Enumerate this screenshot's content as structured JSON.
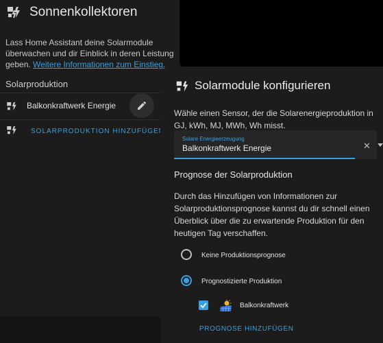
{
  "left_card": {
    "title": "Sonnenkollektoren",
    "description": "Lass Home Assistant deine Solarmodule überwachen und dir Einblick in deren Leistung geben.",
    "link_text": "Weitere Informationen zum Einstieg.",
    "section_label": "Solarproduktion",
    "source_label": "Balkonkraftwerk Energie",
    "add_label": "SOLARPRODUKTION HINZUFÜGEN",
    "icons": [
      "solar-power-icon",
      "pencil-icon"
    ]
  },
  "dialog": {
    "title": "Solarmodule konfigurieren",
    "description": "Wähle einen Sensor, der die Solarenergieproduktion in GJ, kWh, MJ, MWh, Wh misst.",
    "sensor_field": {
      "label": "Solare Energieerzeugung",
      "value": "Balkonkraftwerk Energie"
    },
    "forecast_title": "Prognose der Solarproduktion",
    "forecast_description": "Durch das Hinzufügen von Informationen zur Solarproduktionsprognose kannst du dir schnell einen Überblick über die zu erwartende Produktion für den heutigen Tag verschaffen.",
    "options": [
      {
        "label": "Keine Produktionsprognose",
        "selected": false
      },
      {
        "label": "Prognostizierte Produktion",
        "selected": true
      }
    ],
    "forecast_item": {
      "label": "Balkonkraftwerk",
      "checked": true
    },
    "add_forecast_label": "PROGNOSE HINZUFÜGEN"
  },
  "colors": {
    "accent": "#3aa0e0",
    "card_bg": "#1c1c1c",
    "page_bg": "#111111"
  }
}
